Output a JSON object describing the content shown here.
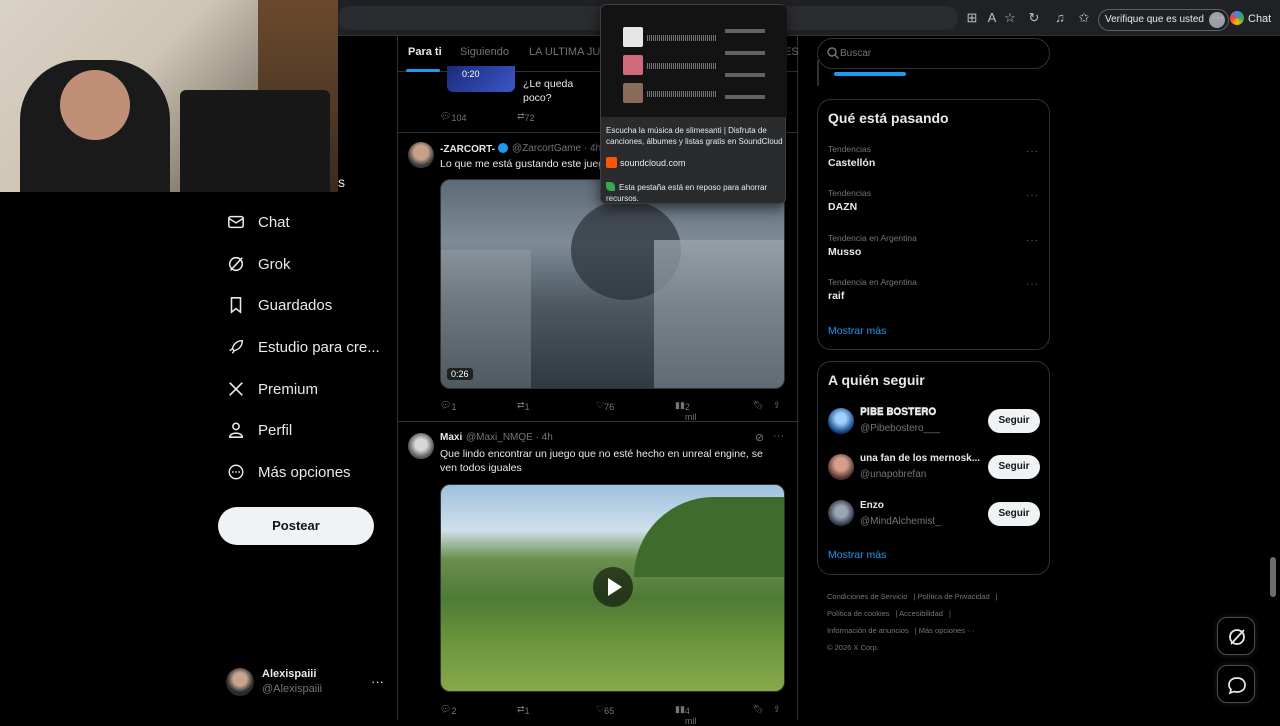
{
  "browser": {
    "verify_label": "Verifique que es usted",
    "chat_label": "Chat"
  },
  "tab_preview": {
    "title": "Escucha la música de slimesanti | Disfruta de canciones, álbumes y listas gratis en SoundCloud",
    "domain": "soundcloud.com",
    "sleep_notice": "Esta pestaña está en reposo para ahorrar recursos."
  },
  "nav": {
    "partial_label": "s",
    "items": [
      {
        "label": "Chat",
        "icon": "chat-icon"
      },
      {
        "label": "Grok",
        "icon": "grok-icon"
      },
      {
        "label": "Guardados",
        "icon": "bookmark-icon"
      },
      {
        "label": "Estudio para cre...",
        "icon": "rocket-icon"
      },
      {
        "label": "Premium",
        "icon": "x-logo-icon"
      },
      {
        "label": "Perfil",
        "icon": "profile-icon"
      },
      {
        "label": "Más opciones",
        "icon": "more-circle-icon"
      }
    ],
    "post_button": "Postear"
  },
  "account": {
    "name": "Alexispaiii",
    "handle": "@Alexispaiii",
    "more": "···"
  },
  "feed_tabs": [
    "Para ti",
    "Siguiendo",
    "LA ULTIMA JUN",
    "ES"
  ],
  "posts": [
    {
      "text": "¿Le queda poco?",
      "video_duration": "0:20",
      "replies": "104",
      "reposts": "72"
    },
    {
      "author": "-ZARCORT-",
      "handle": "@ZarcortGame · 4h",
      "text": "Lo que me está gustando este juego",
      "video_duration": "0:26",
      "replies": "1",
      "reposts": "1",
      "likes": "76",
      "views": "2 mil"
    },
    {
      "author": "Maxi",
      "handle": "@Maxi_NMQE · 4h",
      "text": "Que lindo encontrar un juego que no esté hecho en unreal engine, se ven todos iguales",
      "replies": "2",
      "reposts": "1",
      "likes": "65",
      "views": "4 mil"
    }
  ],
  "search": {
    "placeholder": "Buscar"
  },
  "trends": {
    "title": "Qué está pasando",
    "items": [
      {
        "category": "Tendencias",
        "name": "Castellón"
      },
      {
        "category": "Tendencias",
        "name": "DAZN"
      },
      {
        "category": "Tendencia en Argentina",
        "name": "Musso"
      },
      {
        "category": "Tendencia en Argentina",
        "name": "raif"
      }
    ],
    "more": "···",
    "show_more": "Mostrar más"
  },
  "who_to_follow": {
    "title": "A quién seguir",
    "items": [
      {
        "name": "𝐏𝐈𝐁𝐄 𝐁𝐎𝐒𝐓𝐄𝐑𝐎",
        "handle": "@Pibebostero___",
        "button": "Seguir"
      },
      {
        "name": "una fan de los mernosk...",
        "handle": "@unapobrefan",
        "button": "Seguir"
      },
      {
        "name": "Enzo",
        "handle": "@MindAlchemist_",
        "button": "Seguir"
      }
    ],
    "show_more": "Mostrar más"
  },
  "footer": {
    "links": [
      "Condiciones de Servicio",
      "Política de Privacidad",
      "Política de cookies",
      "Accesibilidad",
      "Información de anuncios",
      "Más opciones ···"
    ],
    "copyright": "© 2026 X Corp."
  },
  "colors": {
    "accent": "#1d9bf0",
    "background": "#000000",
    "border": "#2f3336",
    "muted": "#71767b"
  }
}
